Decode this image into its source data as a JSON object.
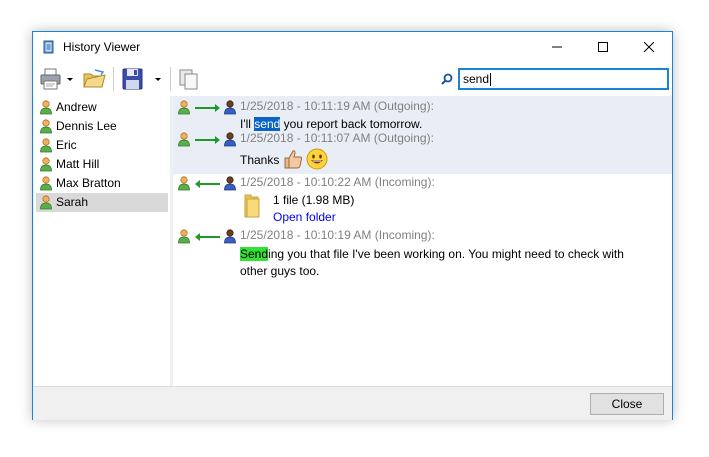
{
  "window": {
    "title": "History Viewer"
  },
  "search": {
    "value": "send"
  },
  "contacts": [
    {
      "name": "Andrew",
      "selected": false
    },
    {
      "name": "Dennis Lee",
      "selected": false
    },
    {
      "name": "Eric",
      "selected": false
    },
    {
      "name": "Matt Hill",
      "selected": false
    },
    {
      "name": "Max Bratton",
      "selected": false
    },
    {
      "name": "Sarah",
      "selected": true
    }
  ],
  "messages": [
    {
      "direction": "Outgoing",
      "header": "1/25/2018 - 10:11:19 AM (Outgoing):",
      "text_before": "I'll ",
      "text_match": "send",
      "text_after": " you report back tomorrow."
    },
    {
      "direction": "Outgoing",
      "header": "1/25/2018 - 10:11:07 AM (Outgoing):",
      "text": "Thanks",
      "emoji": [
        "thumbs-up-icon",
        "smiley-icon"
      ]
    },
    {
      "direction": "Incoming",
      "header": "1/25/2018 - 10:10:22 AM (Incoming):",
      "file_info": "1 file (1.98 MB)",
      "link": "Open folder"
    },
    {
      "direction": "Incoming",
      "header": "1/25/2018 - 10:10:19 AM (Incoming):",
      "text_match": "Send",
      "text_line1_after": "ing you that file I've been working on. You might need to check with",
      "text_line2": "other guys too."
    }
  ],
  "footer": {
    "close_label": "Close"
  },
  "colors": {
    "accent": "#1883d7",
    "selection": "#0a64c8",
    "match_highlight": "#33e233",
    "outgoing_bg": "#e9eef6",
    "header_text": "#808080",
    "link": "#0000ee"
  }
}
